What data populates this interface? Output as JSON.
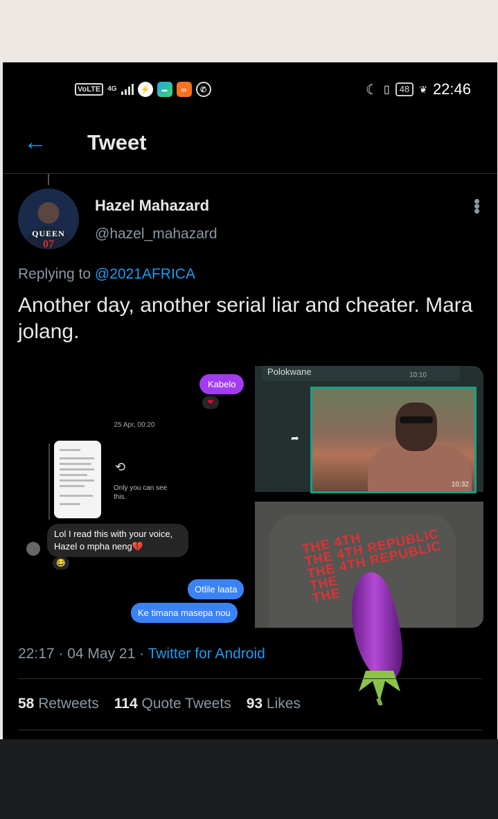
{
  "status_bar": {
    "volte": "VoLTE",
    "network": "4G",
    "battery": "48",
    "time": "22:46"
  },
  "header": {
    "title": "Tweet"
  },
  "tweet": {
    "author_name": "Hazel Mahazard",
    "author_handle": "@hazel_mahazard",
    "avatar_text": "QUEEN",
    "avatar_number": "07",
    "replying_prefix": "Replying to",
    "replying_handle": "@2021AFRICA",
    "text": "Another day, another serial liar and cheater. Mara jolang.",
    "time": "22:17 · 04 May 21 ·",
    "source": "Twitter for Android"
  },
  "media": {
    "chat": {
      "bubble_kabelo": "Kabelo",
      "date": "25 Apr, 00:20",
      "only_you": "Only you can see this.",
      "message_grey": "Lol I read this with your voice, Hazel o mpha neng💔",
      "reply1": "Otlile laata",
      "reply2": "Ke timana masepa nou"
    },
    "whatsapp": {
      "quoted": "Polokwane",
      "quoted_time": "10:10",
      "video_time": "10:32"
    },
    "shirt_text": "THE 4TH\nTHE 4TH REPUBLIC\nTHE 4TH REPUBLIC\nTHE\nTHE"
  },
  "stats": {
    "retweets_count": "58",
    "retweets_label": "Retweets",
    "quotes_count": "114",
    "quotes_label": "Quote Tweets",
    "likes_count": "93",
    "likes_label": "Likes"
  },
  "colors": {
    "accent": "#1d9bf0",
    "background": "#000000",
    "secondary_text": "#8b98a5"
  }
}
